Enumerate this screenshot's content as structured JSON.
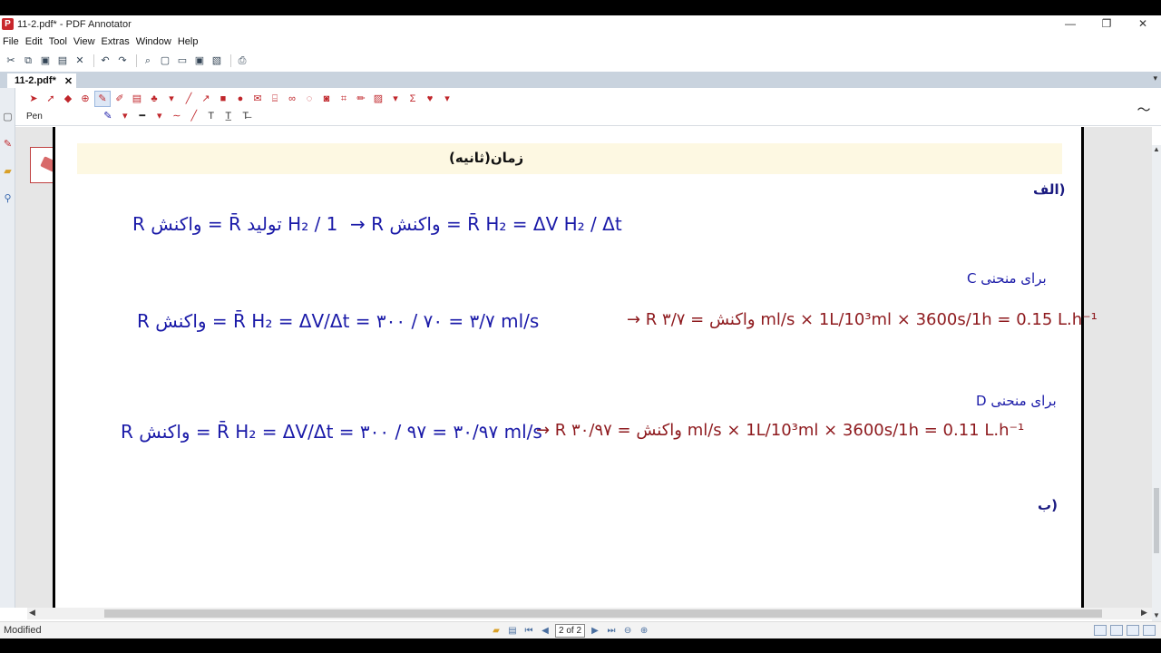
{
  "window": {
    "title": "11-2.pdf* - PDF Annotator",
    "buttons": {
      "minimize": "—",
      "maximize": "❐",
      "close": "✕"
    }
  },
  "menu": [
    "File",
    "Edit",
    "Tool",
    "View",
    "Extras",
    "Window",
    "Help"
  ],
  "tab": {
    "label": "11-2.pdf*",
    "close": "✕"
  },
  "annot_toolbar": {
    "tool_label": "Pen"
  },
  "page_content": {
    "header_title": "زمان(ثانیه)",
    "label_a": "(الف",
    "label_b": "(ب",
    "row_c_label": "برای منحنی C",
    "row_d_label": "برای منحنی D",
    "eq1_left": "R واکنش = R̄ تولید H₂ / 1",
    "eq1_right": "→ R واکنش = R̄ H₂ = ΔV H₂ / Δt",
    "eq2_left": "R واکنش = R̄ H₂ = ΔV/Δt = ۳۰۰ / ۷۰ = ۳/۷ ml/s",
    "eq2_right": "→ R واکنش = ۳/۷ ml/s × 1L/10³ml × 3600s/1h = 0.15 L.h⁻¹",
    "eq3_left": "R واکنش = R̄ H₂ = ΔV/Δt = ۳۰۰ / ۹۷ = ۳۰/۹۷ ml/s",
    "eq3_right": "→ R واکنش = ۳۰/۹۷ ml/s × 1L/10³ml × 3600s/1h = 0.11 L.h⁻¹"
  },
  "status": {
    "left": "Modified",
    "page_indicator": "2 of 2"
  },
  "colors": {
    "ink_blue": "#1a1aa8",
    "ink_red": "#8e1a1e",
    "highlight": "#fdf8e2"
  }
}
